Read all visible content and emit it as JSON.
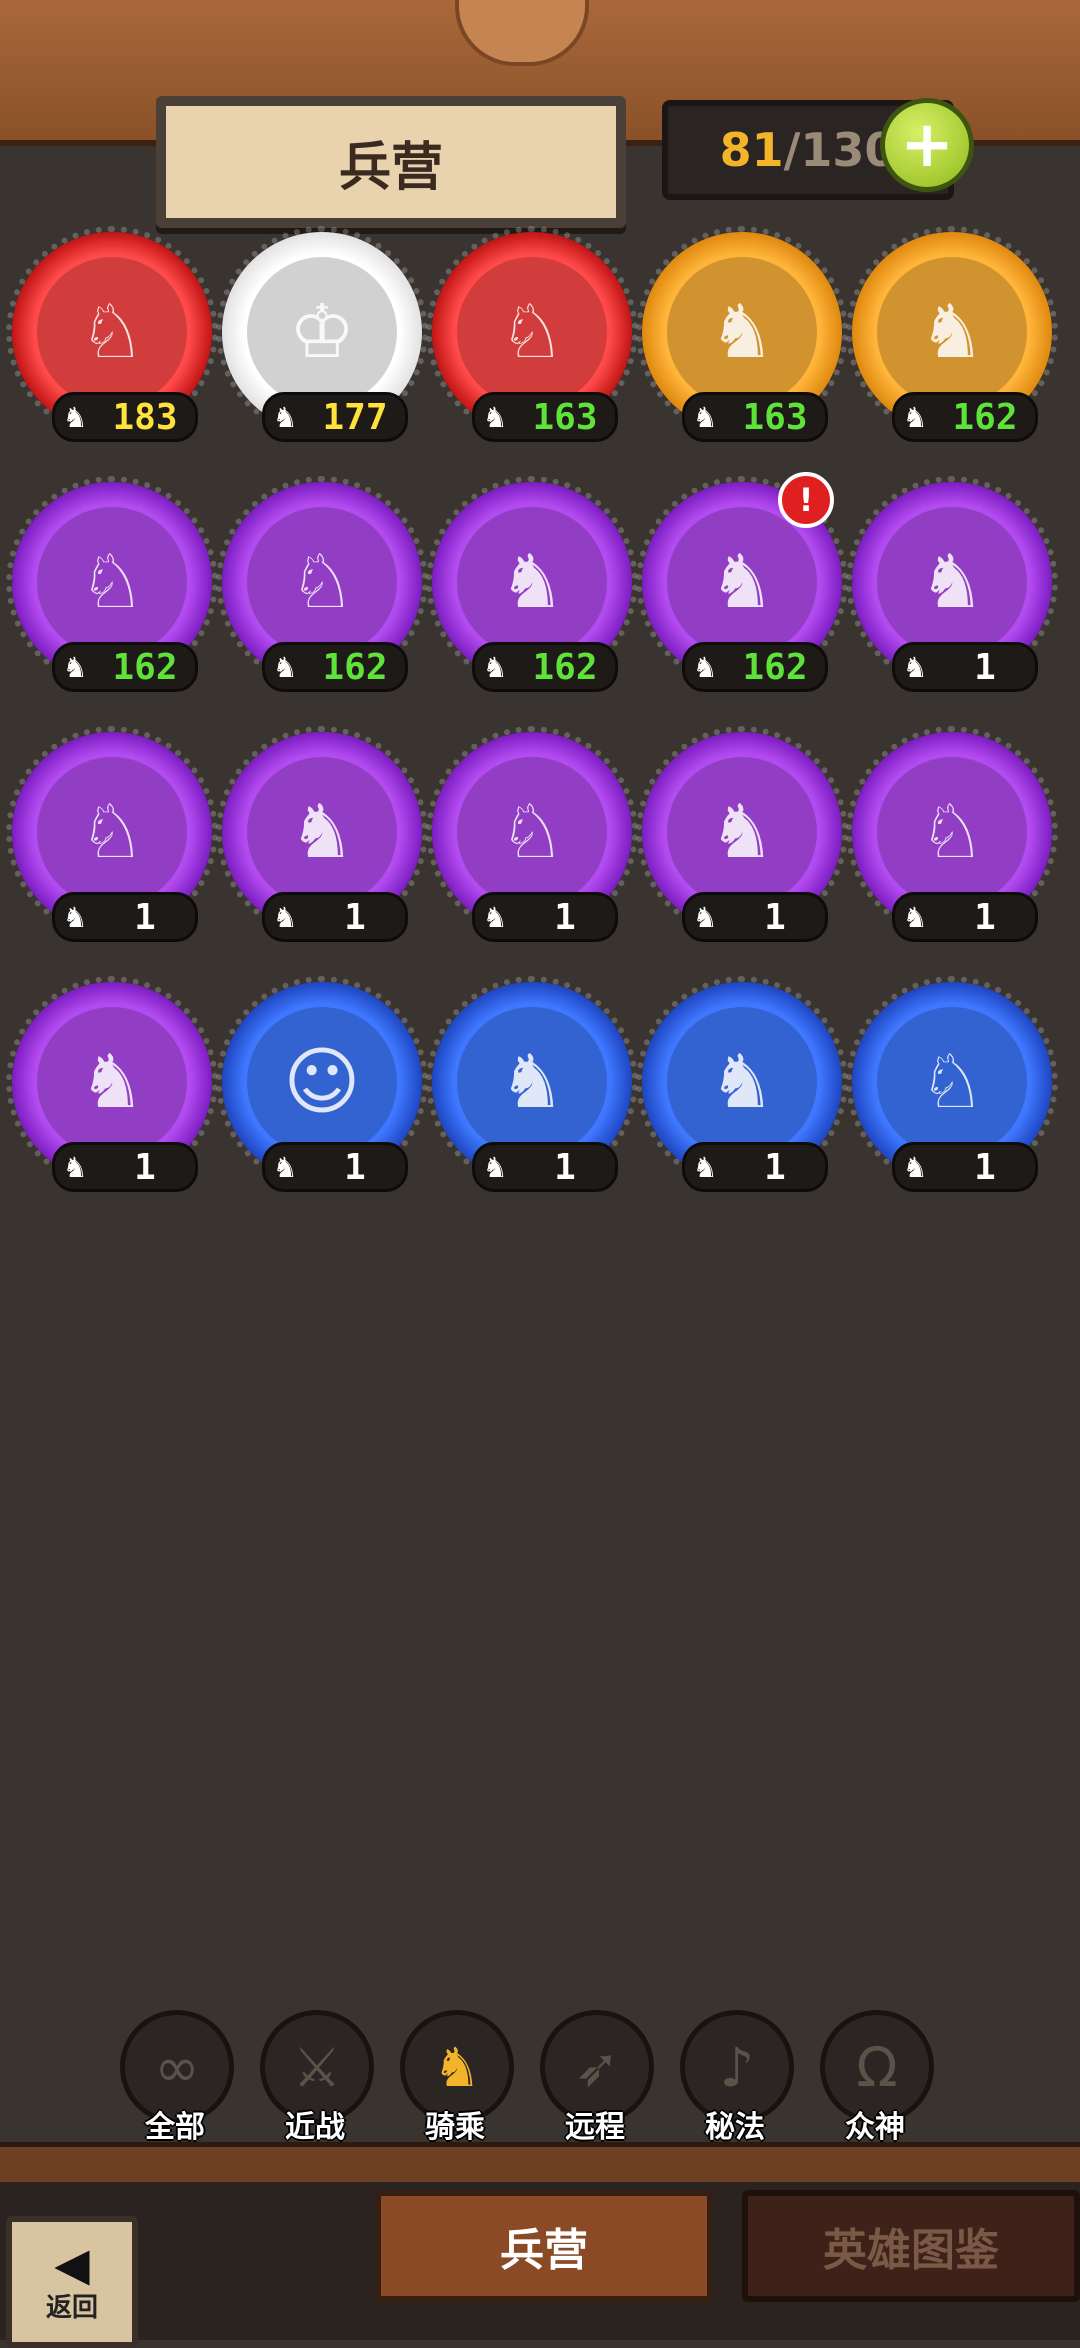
{
  "header": {
    "title": "兵营",
    "count_current": "81",
    "count_separator": "/",
    "count_max": "130",
    "plus_icon": "+"
  },
  "units": [
    {
      "level": "183",
      "frame": "red",
      "level_color": "yellow",
      "portrait": "♘"
    },
    {
      "level": "177",
      "frame": "white",
      "level_color": "yellow",
      "portrait": "♔"
    },
    {
      "level": "163",
      "frame": "red",
      "level_color": "green",
      "portrait": "♘"
    },
    {
      "level": "163",
      "frame": "orange",
      "level_color": "green",
      "portrait": "♞"
    },
    {
      "level": "162",
      "frame": "orange",
      "level_color": "green",
      "portrait": "♞"
    },
    {
      "level": "162",
      "frame": "purple",
      "level_color": "green",
      "portrait": "♘"
    },
    {
      "level": "162",
      "frame": "purple",
      "level_color": "green",
      "portrait": "♘"
    },
    {
      "level": "162",
      "frame": "purple",
      "level_color": "green",
      "portrait": "♞"
    },
    {
      "level": "162",
      "frame": "purple",
      "level_color": "green",
      "portrait": "♞",
      "alert": "!"
    },
    {
      "level": "1",
      "frame": "purple",
      "level_color": "white",
      "portrait": "♞"
    },
    {
      "level": "1",
      "frame": "purple",
      "level_color": "white",
      "portrait": "♘"
    },
    {
      "level": "1",
      "frame": "purple",
      "level_color": "white",
      "portrait": "♞"
    },
    {
      "level": "1",
      "frame": "purple",
      "level_color": "white",
      "portrait": "♘"
    },
    {
      "level": "1",
      "frame": "purple",
      "level_color": "white",
      "portrait": "♞"
    },
    {
      "level": "1",
      "frame": "purple",
      "level_color": "white",
      "portrait": "♘"
    },
    {
      "level": "1",
      "frame": "purple",
      "level_color": "white",
      "portrait": "♞"
    },
    {
      "level": "1",
      "frame": "blue",
      "level_color": "white",
      "portrait": "☺"
    },
    {
      "level": "1",
      "frame": "blue",
      "level_color": "white",
      "portrait": "♞"
    },
    {
      "level": "1",
      "frame": "blue",
      "level_color": "white",
      "portrait": "♞"
    },
    {
      "level": "1",
      "frame": "blue",
      "level_color": "white",
      "portrait": "♘"
    }
  ],
  "horse_icon": "♞",
  "filters": [
    {
      "label": "全部",
      "icon": "∞",
      "icon_name": "infinity-icon",
      "active": false
    },
    {
      "label": "近战",
      "icon": "⚔",
      "icon_name": "sword-icon",
      "active": false
    },
    {
      "label": "骑乘",
      "icon": "♞",
      "icon_name": "horse-icon",
      "active": true
    },
    {
      "label": "远程",
      "icon": "➶",
      "icon_name": "bow-icon",
      "active": false
    },
    {
      "label": "秘法",
      "icon": "♪",
      "icon_name": "arcane-icon",
      "active": false
    },
    {
      "label": "众神",
      "icon": "Ω",
      "icon_name": "omega-icon",
      "active": false
    }
  ],
  "bottom_tabs": {
    "barracks": "兵营",
    "hero_guide": "英雄图鉴"
  },
  "back": {
    "label": "返回",
    "arrow": "◀"
  },
  "colors": {
    "active_filter": "#f3b42a",
    "count_current": "#f3b42a",
    "level_green": "#5fe23a",
    "level_yellow": "#ffe23a"
  }
}
